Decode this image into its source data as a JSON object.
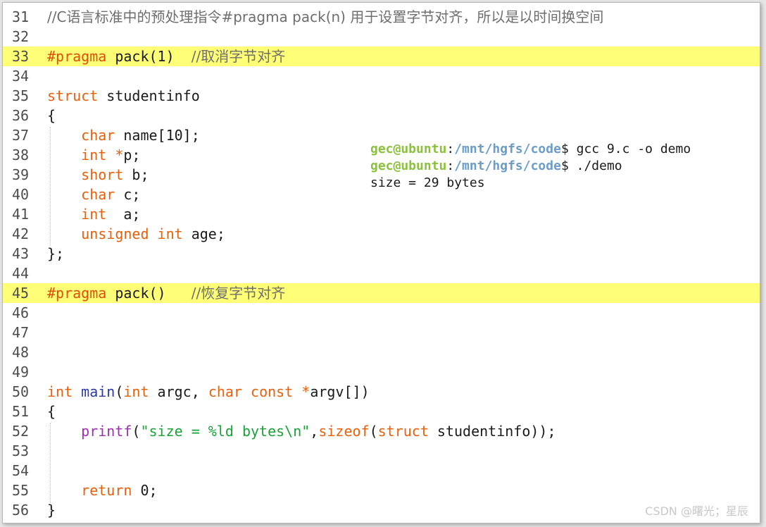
{
  "lines": [
    {
      "n": "31",
      "comment": "//C语言标准中的预处理指令#pragma pack(n) 用于设置字节对齐，所以是以时间换空间"
    },
    {
      "n": "32"
    },
    {
      "n": "33",
      "directive": "#pragma",
      "rest": " pack(1)  ",
      "comment": "//取消字节对齐"
    },
    {
      "n": "34"
    },
    {
      "n": "35",
      "kw": "struct",
      "rest": " studentinfo"
    },
    {
      "n": "36",
      "rest": "{"
    },
    {
      "n": "37",
      "indent": "    ",
      "type": "char",
      "rest": " name[10];"
    },
    {
      "n": "38",
      "indent": "    ",
      "type": "int",
      "star": " *",
      "rest": "p;"
    },
    {
      "n": "39",
      "indent": "    ",
      "type": "short",
      "rest": " b;"
    },
    {
      "n": "40",
      "indent": "    ",
      "type": "char",
      "rest": " c;"
    },
    {
      "n": "41",
      "indent": "    ",
      "type": "int",
      "rest": "  a;"
    },
    {
      "n": "42",
      "indent": "    ",
      "type": "unsigned",
      "type2": " int",
      "rest": " age;"
    },
    {
      "n": "43",
      "rest": "};"
    },
    {
      "n": "44"
    },
    {
      "n": "45",
      "directive": "#pragma",
      "rest": " pack()   ",
      "comment": "//恢复字节对齐"
    },
    {
      "n": "46"
    },
    {
      "n": "47"
    },
    {
      "n": "48"
    },
    {
      "n": "49"
    },
    {
      "n": "50",
      "main": {
        "t1": "int",
        "name": "main",
        "open": "(",
        "t2": "int",
        "a1": " argc, ",
        "t3": "char",
        "t4": " const",
        "star": " *",
        "a2": "argv[])"
      }
    },
    {
      "n": "51",
      "rest": "{"
    },
    {
      "n": "52",
      "printf": {
        "fn": "printf",
        "p1": "(",
        "str": "\"size = %ld bytes\\n\"",
        "comma": ",",
        "so": "sizeof",
        "p2": "(",
        "st": "struct",
        "tail": " studentinfo));"
      }
    },
    {
      "n": "53"
    },
    {
      "n": "54"
    },
    {
      "n": "55",
      "indent": "    ",
      "kwr": "return",
      "rest": " 0;"
    },
    {
      "n": "56",
      "rest": "}"
    }
  ],
  "terminal": [
    {
      "user": "gec@ubuntu",
      "sep": ":",
      "path": "/mnt/hgfs/code",
      "prompt": "$ ",
      "cmd": "gcc 9.c -o demo"
    },
    {
      "user": "gec@ubuntu",
      "sep": ":",
      "path": "/mnt/hgfs/code",
      "prompt": "$ ",
      "cmd": "./demo"
    },
    {
      "output": "size = 29 bytes"
    }
  ],
  "highlighted_lines": [
    "33",
    "45"
  ],
  "watermark": "CSDN @曙光；星辰",
  "colors": {
    "highlight": "#ffff77",
    "keyword": "#e8600b",
    "function": "#2b3aa8",
    "printf": "#9b2fae",
    "string": "#17a336",
    "comment": "#6e6e6e",
    "term_user": "#8ac23a",
    "term_path": "#6b9dc8"
  }
}
